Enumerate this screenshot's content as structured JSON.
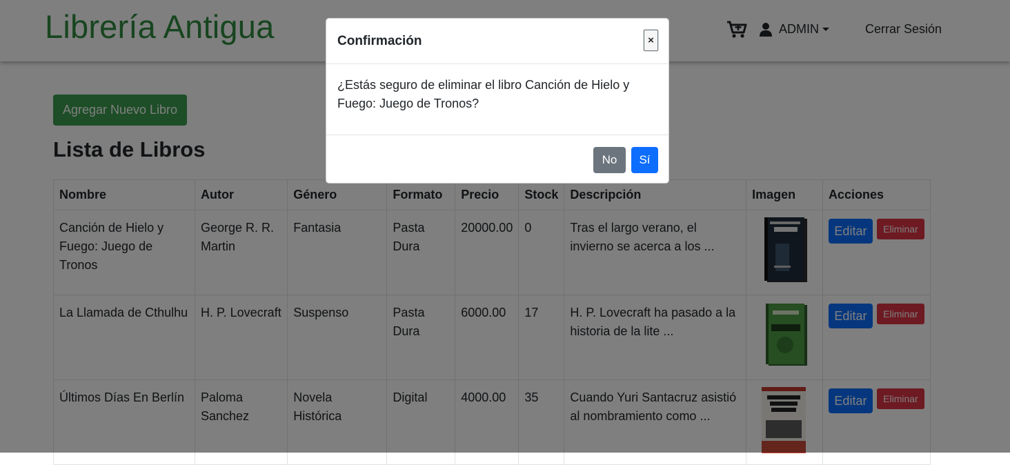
{
  "navbar": {
    "brand": "Librería Antigua",
    "cart_icon": "cart-plus-icon",
    "user_icon": "user-icon",
    "user_label": "ADMIN",
    "logout_label": "Cerrar Sesión"
  },
  "main": {
    "add_button_label": "Agregar Nuevo Libro",
    "list_title": "Lista de Libros",
    "table": {
      "headers": [
        "Nombre",
        "Autor",
        "Género",
        "Formato",
        "Precio",
        "Stock",
        "Descripción",
        "Imagen",
        "Acciones"
      ],
      "rows": [
        {
          "nombre": "Canción de Hielo y Fuego: Juego de Tronos",
          "autor": "George R. R. Martin",
          "genero": "Fantasia",
          "formato": "Pasta Dura",
          "precio": "20000.00",
          "stock": "0",
          "descripcion": "Tras el largo verano, el invierno se acerca a los ...",
          "edit_label": "Editar",
          "delete_label": "Eliminar"
        },
        {
          "nombre": "La Llamada de Cthulhu",
          "autor": "H. P. Lovecraft",
          "genero": "Suspenso",
          "formato": "Pasta Dura",
          "precio": "6000.00",
          "stock": "17",
          "descripcion": "H. P. Lovecraft ha pasado a la historia de la lite ...",
          "edit_label": "Editar",
          "delete_label": "Eliminar"
        },
        {
          "nombre": "Últimos Días En Berlín",
          "autor": "Paloma Sanchez",
          "genero": "Novela Histórica",
          "formato": "Digital",
          "precio": "4000.00",
          "stock": "35",
          "descripcion": "Cuando Yuri Santacruz asistió al nombramiento como ...",
          "edit_label": "Editar",
          "delete_label": "Eliminar"
        }
      ]
    }
  },
  "modal": {
    "title": "Confirmación",
    "close_label": "×",
    "message": "¿Estás seguro de eliminar el libro Canción de Hielo y Fuego: Juego de Tronos?",
    "no_label": "No",
    "yes_label": "Sí"
  },
  "colors": {
    "brand_green": "#2e8b3e",
    "add_button": "#3a9d4f",
    "primary": "#0d6efd",
    "danger": "#dc3545",
    "secondary": "#6c757d"
  }
}
